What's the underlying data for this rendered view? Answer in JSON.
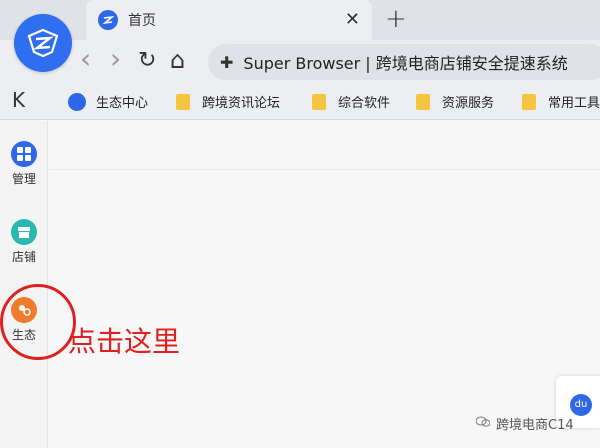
{
  "tab": {
    "title": "首页",
    "close_glyph": "✕",
    "new_glyph": "+"
  },
  "toolbar": {
    "back_glyph": "‹",
    "forward_glyph": "›",
    "reload_glyph": "↻",
    "home_glyph": "⌂",
    "puzzle_glyph": "✚",
    "url": "Super Browser | 跨境电商店铺安全提速系统"
  },
  "bookmarks": {
    "collapse_glyph": "K",
    "items": [
      {
        "label": "生态中心",
        "icon": "app-logo-icon"
      },
      {
        "label": "跨境资讯论坛",
        "icon": "folder-icon"
      },
      {
        "label": "综合软件",
        "icon": "folder-icon"
      },
      {
        "label": "资源服务",
        "icon": "folder-icon"
      },
      {
        "label": "常用工具",
        "icon": "folder-icon"
      }
    ]
  },
  "sidebar": {
    "items": [
      {
        "label": "管理",
        "icon": "grid-icon",
        "color": "#2f67e8"
      },
      {
        "label": "店铺",
        "icon": "store-icon",
        "color": "#2bb8b0"
      },
      {
        "label": "生态",
        "icon": "ecosystem-icon",
        "color": "#f07b2c"
      }
    ]
  },
  "annotation": {
    "text": "点击这里"
  },
  "watermark": {
    "text": "跨境电商C14"
  },
  "baidu": {
    "label": "du"
  },
  "colors": {
    "accent": "#2f67e8",
    "annotation": "#e02020",
    "folder": "#f5c542"
  }
}
